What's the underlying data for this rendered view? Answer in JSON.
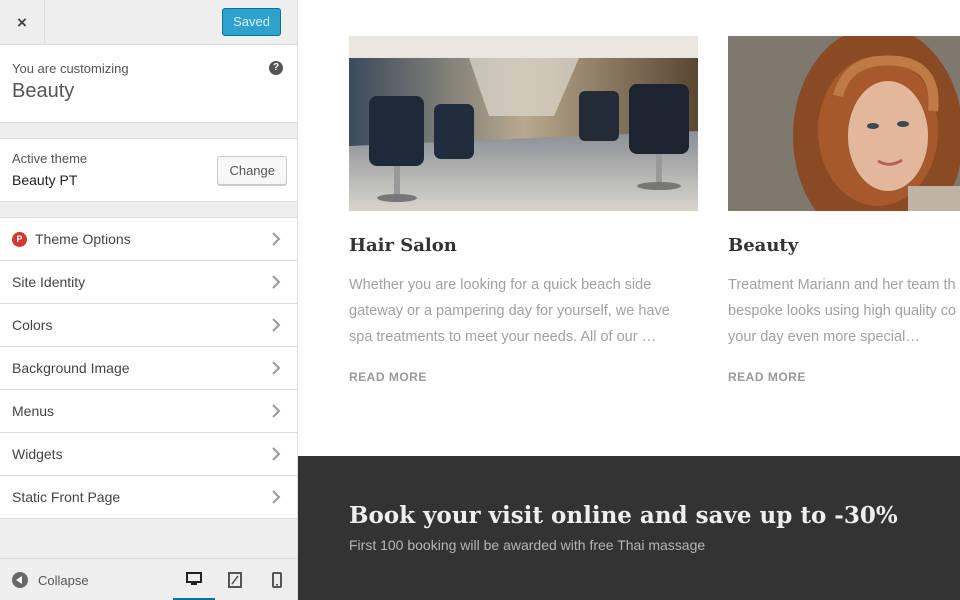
{
  "topbar": {
    "close_label": "×",
    "saved_label": "Saved"
  },
  "info": {
    "label": "You are customizing",
    "site_title": "Beauty",
    "help": "?"
  },
  "theme": {
    "label": "Active theme",
    "name": "Beauty PT",
    "change_label": "Change"
  },
  "sections": [
    {
      "label": "Theme Options",
      "icon": "P"
    },
    {
      "label": "Site Identity"
    },
    {
      "label": "Colors"
    },
    {
      "label": "Background Image"
    },
    {
      "label": "Menus"
    },
    {
      "label": "Widgets"
    },
    {
      "label": "Static Front Page"
    }
  ],
  "footer": {
    "collapse_label": "Collapse"
  },
  "cards": [
    {
      "title": "Hair Salon",
      "text": [
        "Whether you are looking for a quick beach side",
        "gateway or a pampering day for yourself, we have",
        "spa treatments to meet your needs. All of our …"
      ],
      "read_more": "READ MORE"
    },
    {
      "title": "Beauty",
      "text": [
        "Treatment Mariann and her team th",
        "bespoke looks using high quality co",
        "your day even more special…"
      ],
      "read_more": "READ MORE"
    }
  ],
  "banner": {
    "title": "Book your visit online and save up to -30%",
    "subtitle": "First 100 booking will be awarded with free Thai massage"
  },
  "colors": {
    "accent": "#2ea2cc",
    "banner_bg": "#333333",
    "brand_red": "#d0392b"
  }
}
